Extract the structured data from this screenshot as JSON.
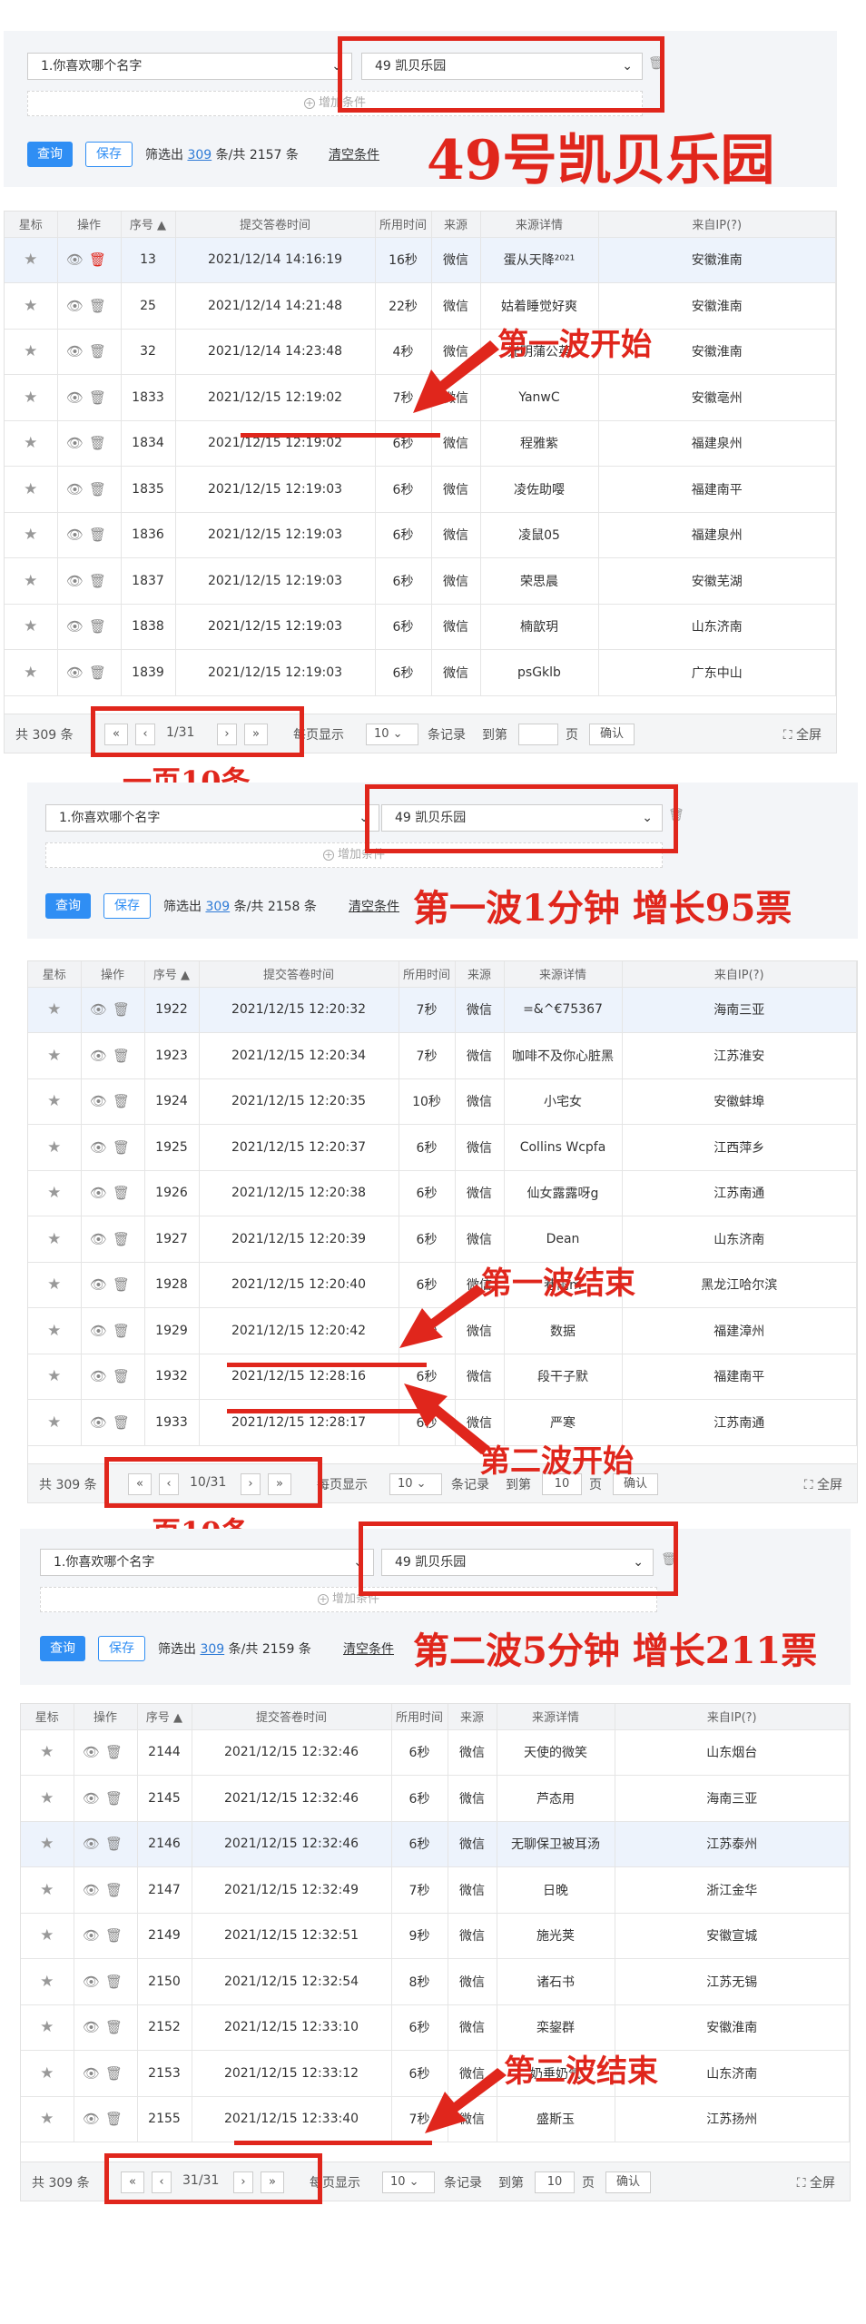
{
  "common": {
    "question_select": "1.你喜欢哪个名字",
    "option_select": "49 凯贝乐园",
    "add_condition": "增加条件",
    "query_btn": "查询",
    "save_btn": "保存",
    "filtered_prefix": "筛选出",
    "filtered_mid": "条/共",
    "filtered_suffix": "条",
    "clear_filter": "清空条件",
    "star_icon": "★",
    "columns": [
      "星标",
      "操作",
      "序号 ▲",
      "提交答卷时间",
      "所用时间",
      "来源",
      "来源详情",
      "来自IP(?)"
    ],
    "pager": {
      "total": "共 309 条",
      "per_page_label": "每页显示",
      "per_page": "10",
      "records": "条记录",
      "goto": "到第",
      "page_unit": "页",
      "confirm": "确认",
      "fullscreen": "全屏"
    }
  },
  "sections": [
    {
      "filtered_count": "309",
      "total_count": "2157",
      "annotation": "49号凯贝乐园",
      "page_indicator": "1/31",
      "goto_value": "",
      "rows": [
        [
          "13",
          "2021/12/14 14:16:19",
          "16秒",
          "微信",
          "蛋从天降²⁰²¹",
          "安徽淮南"
        ],
        [
          "25",
          "2021/12/14 14:21:48",
          "22秒",
          "微信",
          "姑着睡觉好爽",
          "安徽淮南"
        ],
        [
          "32",
          "2021/12/14 14:23:48",
          "4秒",
          "微信",
          "光明蒲公英",
          "安徽淮南"
        ],
        [
          "1833",
          "2021/12/15 12:19:02",
          "7秒",
          "微信",
          "YanwC",
          "安徽亳州"
        ],
        [
          "1834",
          "2021/12/15 12:19:02",
          "6秒",
          "微信",
          "程雅紫",
          "福建泉州"
        ],
        [
          "1835",
          "2021/12/15 12:19:03",
          "6秒",
          "微信",
          "凌佐助嘤",
          "福建南平"
        ],
        [
          "1836",
          "2021/12/15 12:19:03",
          "6秒",
          "微信",
          "凌鼠05",
          "福建泉州"
        ],
        [
          "1837",
          "2021/12/15 12:19:03",
          "6秒",
          "微信",
          "荣思晨",
          "安徽芜湖"
        ],
        [
          "1838",
          "2021/12/15 12:19:03",
          "6秒",
          "微信",
          "楠歆玥",
          "山东济南"
        ],
        [
          "1839",
          "2021/12/15 12:19:03",
          "6秒",
          "微信",
          "psGklb",
          "广东中山"
        ]
      ],
      "callouts": [
        "第一波开始",
        "一页10条"
      ]
    },
    {
      "filtered_count": "309",
      "total_count": "2158",
      "annotation": "第一波1分钟 增长95票",
      "page_indicator": "10/31",
      "goto_value": "10",
      "rows": [
        [
          "1922",
          "2021/12/15 12:20:32",
          "7秒",
          "微信",
          "=&^€75367",
          "海南三亚"
        ],
        [
          "1923",
          "2021/12/15 12:20:34",
          "7秒",
          "微信",
          "咖啡不及你心脏黑",
          "江苏淮安"
        ],
        [
          "1924",
          "2021/12/15 12:20:35",
          "10秒",
          "微信",
          "小宅女",
          "安徽蚌埠"
        ],
        [
          "1925",
          "2021/12/15 12:20:37",
          "6秒",
          "微信",
          "Collins Wcpfa",
          "江西萍乡"
        ],
        [
          "1926",
          "2021/12/15 12:20:38",
          "6秒",
          "微信",
          "仙女露露呀g",
          "江苏南通"
        ],
        [
          "1927",
          "2021/12/15 12:20:39",
          "6秒",
          "微信",
          "Dean",
          "山东济南"
        ],
        [
          "1928",
          "2021/12/15 12:20:40",
          "6秒",
          "微信",
          "巷雨m",
          "黑龙江哈尔滨"
        ],
        [
          "1929",
          "2021/12/15 12:20:42",
          "0秒",
          "微信",
          "数据",
          "福建漳州"
        ],
        [
          "1932",
          "2021/12/15 12:28:16",
          "6秒",
          "微信",
          "段干子默",
          "福建南平"
        ],
        [
          "1933",
          "2021/12/15 12:28:17",
          "6秒",
          "微信",
          "严寒",
          "江苏南通"
        ]
      ],
      "callouts": [
        "第一波结束",
        "第二波开始",
        "一页10条"
      ]
    },
    {
      "filtered_count": "309",
      "total_count": "2159",
      "annotation": "第二波5分钟 增长211票",
      "page_indicator": "31/31",
      "goto_value": "10",
      "rows": [
        [
          "2144",
          "2021/12/15 12:32:46",
          "6秒",
          "微信",
          "天使的微笑",
          "山东烟台"
        ],
        [
          "2145",
          "2021/12/15 12:32:46",
          "6秒",
          "微信",
          "芦态用",
          "海南三亚"
        ],
        [
          "2146",
          "2021/12/15 12:32:46",
          "6秒",
          "微信",
          "无聊保卫被耳汤",
          "江苏泰州"
        ],
        [
          "2147",
          "2021/12/15 12:32:49",
          "7秒",
          "微信",
          "日晚",
          "浙江金华"
        ],
        [
          "2149",
          "2021/12/15 12:32:51",
          "9秒",
          "微信",
          "施光荚",
          "安徽宣城"
        ],
        [
          "2150",
          "2021/12/15 12:32:54",
          "8秒",
          "微信",
          "诸石书",
          "江苏无锡"
        ],
        [
          "2152",
          "2021/12/15 12:33:10",
          "6秒",
          "微信",
          "栾鋆群",
          "安徽淮南"
        ],
        [
          "2153",
          "2021/12/15 12:33:12",
          "6秒",
          "微信",
          "奶垂奶气",
          "山东济南"
        ],
        [
          "2155",
          "2021/12/15 12:33:40",
          "7秒",
          "微信",
          "盛斯玉",
          "江苏扬州"
        ]
      ],
      "callouts": [
        "第二波结束"
      ]
    }
  ]
}
